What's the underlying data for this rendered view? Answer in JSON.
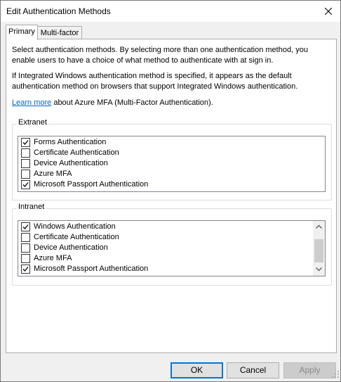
{
  "window": {
    "title": "Edit Authentication Methods"
  },
  "tabs": [
    {
      "label": "Primary",
      "active": true
    },
    {
      "label": "Multi-factor",
      "active": false
    }
  ],
  "primary": {
    "intro": "Select authentication methods. By selecting more than one authentication method, you enable users to have a choice of what method to authenticate with at sign in.",
    "integrated_note": "If Integrated Windows authentication method is specified, it appears as the default authentication method on browsers that support Integrated Windows authentication.",
    "learn_more_link": "Learn more",
    "learn_more_rest": " about Azure MFA (Multi-Factor Authentication).",
    "extranet": {
      "label": "Extranet",
      "items": [
        {
          "label": "Forms Authentication",
          "checked": true
        },
        {
          "label": "Certificate Authentication",
          "checked": false
        },
        {
          "label": "Device Authentication",
          "checked": false
        },
        {
          "label": "Azure MFA",
          "checked": false
        },
        {
          "label": "Microsoft Passport Authentication",
          "checked": true
        }
      ]
    },
    "intranet": {
      "label": "Intranet",
      "items": [
        {
          "label": "Windows Authentication",
          "checked": true
        },
        {
          "label": "Certificate Authentication",
          "checked": false
        },
        {
          "label": "Device Authentication",
          "checked": false
        },
        {
          "label": "Azure MFA",
          "checked": false
        },
        {
          "label": "Microsoft Passport Authentication",
          "checked": true
        }
      ]
    }
  },
  "buttons": {
    "ok": "OK",
    "cancel": "Cancel",
    "apply": "Apply"
  }
}
